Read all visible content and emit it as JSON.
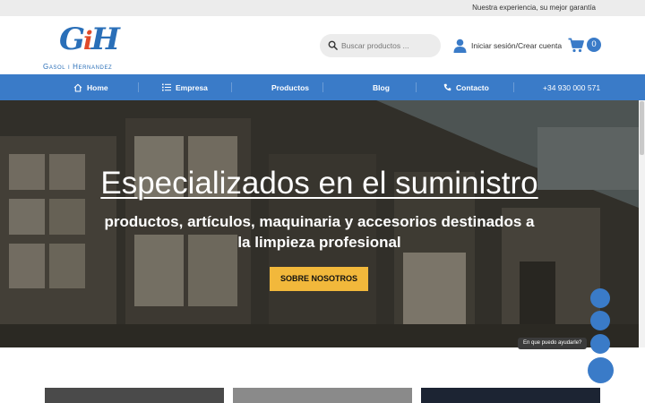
{
  "topbar": {
    "tagline": "Nuestra experiencia, su mejor garantía"
  },
  "logo": {
    "monogram_g": "G",
    "monogram_i": "i",
    "monogram_h": "H",
    "brand": "Gasol i Hernandez"
  },
  "search": {
    "placeholder": "Buscar productos ..."
  },
  "account": {
    "label": "Iniciar sesión/Crear cuenta"
  },
  "cart": {
    "count": "0"
  },
  "nav": {
    "items": [
      {
        "label": "Home",
        "icon": "home-icon"
      },
      {
        "label": "Empresa",
        "icon": "list-icon"
      },
      {
        "label": "Productos"
      },
      {
        "label": "Blog"
      },
      {
        "label": "Contacto",
        "icon": "phone-icon"
      }
    ],
    "phone": "+34 930 000 571"
  },
  "hero": {
    "title": "Especializados en el suministro",
    "subtitle": "productos, artículos, maquinaria y accesorios destinados a la limpieza profesional",
    "cta": "SOBRE NOSOTROS"
  },
  "help": {
    "bubble": "En que puedo ayudarle?"
  },
  "colors": {
    "brand_blue": "#3a7bc8",
    "accent_orange": "#e04a2a",
    "cta_yellow": "#f2b83b"
  }
}
